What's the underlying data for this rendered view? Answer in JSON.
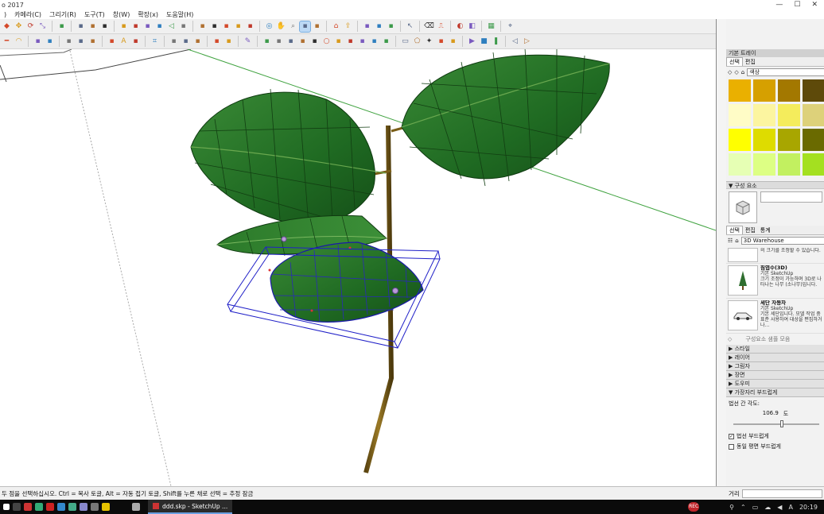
{
  "window": {
    "title": "o 2017",
    "controls": [
      "—",
      "☐",
      "✕"
    ]
  },
  "menubar": {
    "items": [
      ")",
      "카메라(C)",
      "그리기(R)",
      "도구(T)",
      "창(W)",
      "확장(x)",
      "도움말(H)"
    ]
  },
  "toolbar1": {
    "icons": [
      "paint-icon",
      "move-icon",
      "rotate-icon",
      "scale-icon",
      "sep",
      "component-icon",
      "sep",
      "box-icon",
      "cube-icon",
      "cylinder-icon",
      "sep",
      "iso-icon",
      "top-icon",
      "front-icon",
      "right-icon",
      "back-icon",
      "left-icon",
      "sep",
      "xray-icon",
      "wire-icon",
      "hidden-icon",
      "shaded-icon",
      "textured-icon",
      "sep",
      "orbit-icon",
      "pan-icon",
      "zoom-icon",
      "zoom-window-icon",
      "zoom-extents-icon",
      "sep",
      "warehouse-icon",
      "share-icon",
      "sep",
      "sandbox-icon",
      "stamp-icon",
      "drape-icon",
      "sep",
      "select-icon",
      "sep",
      "eraser-icon",
      "tape-icon",
      "sep",
      "styles-icon",
      "solid-icon",
      "sep",
      "materials-icon",
      "sep",
      "profile-icon"
    ],
    "active_index": 27
  },
  "toolbar2": {
    "icons": [
      "line-icon",
      "arc-icon",
      "sep",
      "move2-icon",
      "push-icon",
      "sep",
      "section-icon",
      "grid-icon",
      "grid2-icon",
      "sep",
      "dimension-icon",
      "text-icon",
      "axes-icon",
      "sep",
      "tag-icon",
      "sep",
      "lasso-icon",
      "fence-icon",
      "bend-icon",
      "sep",
      "curve-icon",
      "spline-icon",
      "sep",
      "pen-icon",
      "sep",
      "bezier-icon",
      "polyline-icon",
      "catmull-icon",
      "bspline-icon",
      "loop-icon",
      "circle-icon",
      "ellipse-icon",
      "spiral-icon",
      "fillet-icon",
      "divide-icon",
      "angle-icon",
      "sep",
      "rect-icon",
      "poly-icon",
      "star-icon",
      "leaf-icon",
      "rose-icon",
      "sep",
      "play-icon",
      "stop-icon",
      "pause-icon",
      "sep",
      "back-icon",
      "next-icon"
    ]
  },
  "panel": {
    "title": "기본 트레이",
    "materials": {
      "tabs": [
        "선택",
        "편집"
      ],
      "library": "색상",
      "swatches": [
        "#eab000",
        "#d6a000",
        "#a37800",
        "#5e4a0a",
        "#fffcc6",
        "#fcf5a0",
        "#f4ec5c",
        "#ddd17a",
        "#ffff00",
        "#dedc00",
        "#a8a600",
        "#6a6a00",
        "#e6ffb4",
        "#ddff84",
        "#c2f060",
        "#a4e020"
      ]
    },
    "components": {
      "header": "구성 요소",
      "tabs": [
        "선택",
        "편집",
        "통계"
      ],
      "search": "3D Warehouse",
      "items": [
        {
          "title": "",
          "author": "",
          "desc": "의 크기를 조정할 수 있습니다."
        },
        {
          "title": "침엽수(3D)",
          "author": "기본 SketchUp",
          "desc": "크기 조정이 가능하며 3D로 나타나는 나무 (소나무)입니다."
        },
        {
          "title": "세단 자동차",
          "author": "기본 SketchUp",
          "desc": "기본 세단입니다. 모델 작업 중 표준 사용하여 대상을 편집하거나..."
        }
      ],
      "footer": "구성요소 샘플 모음"
    },
    "collapsed_sections": [
      "스타일",
      "레이어",
      "그림자",
      "장면",
      "도우미"
    ],
    "soften": {
      "header": "가장자리 부드럽게",
      "angle_label": "법선 간 각도:",
      "angle_value": "106.9",
      "angle_unit": "도",
      "slider_value": 0.55,
      "check1": "법선 부드럽게",
      "check2": "동일 평면 부드럽게"
    }
  },
  "statusbar": {
    "hint": "두 점을 선택하십시오. Ctrl = 복사 토글, Alt = 자동 접기 토글, Shift를 누른 채로 선택 = 추정 잠금",
    "measure_label": "거리"
  },
  "taskbar": {
    "app_label": "ddd.skp - SketchUp ...",
    "rec_label": "REC",
    "lang": "A",
    "time": "20:19"
  }
}
